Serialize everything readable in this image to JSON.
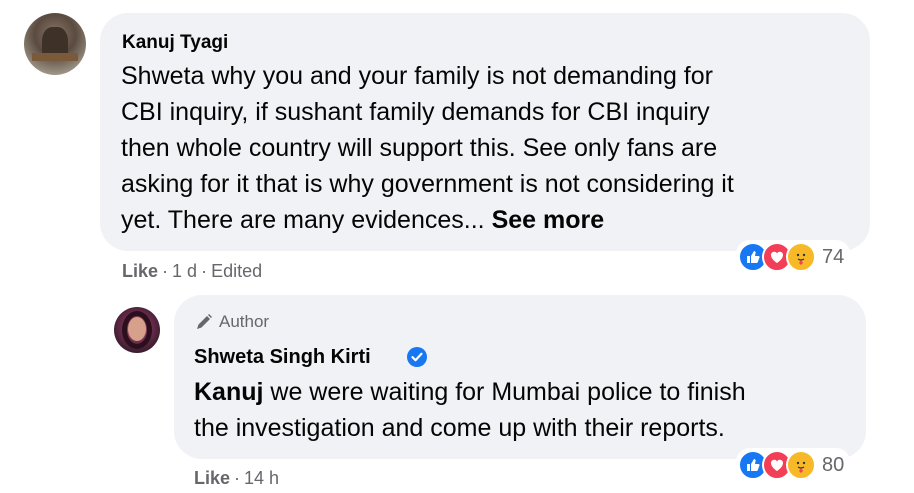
{
  "comment": {
    "author": "Kanuj Tyagi",
    "text_lines": [
      "Shweta why you and your family is not demanding for",
      "CBI inquiry, if sushant family demands for CBI inquiry",
      "then whole country will support this. See only fans are",
      "asking for it that is why government is not considering it",
      "yet. There are many evidences... "
    ],
    "see_more": "See more",
    "like": "Like",
    "time": "1 d",
    "edited": "Edited",
    "reaction_icons": [
      "like-icon",
      "love-icon",
      "care-icon"
    ],
    "reaction_count": "74"
  },
  "reply": {
    "badge": "Author",
    "author": "Shweta Singh Kirti",
    "mention": "Kanuj",
    "text_line1_rest": " we were waiting for Mumbai police to finish",
    "text_line2": "the investigation and come up with their reports.",
    "like": "Like",
    "time": "14 h",
    "reaction_icons": [
      "like-icon",
      "love-icon",
      "care-icon"
    ],
    "reaction_count": "80"
  },
  "colors": {
    "bubble": "#f0f2f5",
    "meta_text": "#65676b",
    "verified": "#1877f2",
    "like": "#1877f2",
    "love": "#f33e58",
    "care": "#f7b928"
  }
}
